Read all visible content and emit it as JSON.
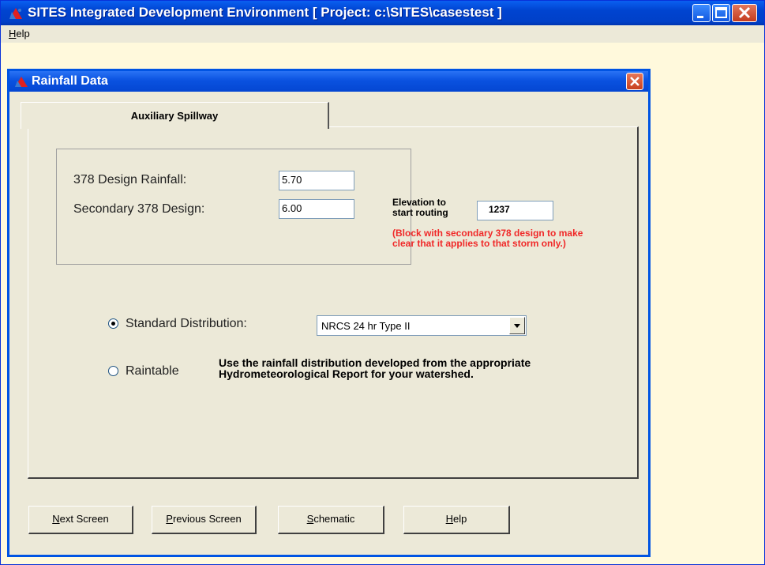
{
  "window": {
    "title": "SITES Integrated Development Environment [ Project: c:\\SITES\\casestest ]"
  },
  "menu": {
    "help_underlined": "H",
    "help_rest": "elp"
  },
  "dialog": {
    "title": "Rainfall Data",
    "tab_label": "Auxiliary Spillway",
    "design_rainfall_label": "378 Design Rainfall:",
    "design_rainfall_value": "5.70",
    "secondary_label": "Secondary 378 Design:",
    "secondary_value": "6.00",
    "elevation_label_1": "Elevation to",
    "elevation_label_2": "start routing",
    "elevation_value": "1237",
    "red_note": "(Block with secondary 378 design to make clear that it applies to that storm only.)",
    "standard_label": "Standard Distribution:",
    "standard_selected": true,
    "distribution_value": "NRCS 24 hr Type II",
    "raintable_label": "Raintable",
    "raintable_selected": false,
    "raintable_info": "Use the rainfall distribution developed from the appropriate Hydrometeorological Report for your watershed."
  },
  "buttons": {
    "next_u": "N",
    "next_rest": "ext Screen",
    "prev_u": "P",
    "prev_rest": "revious Screen",
    "schem_u": "S",
    "schem_rest": "chematic",
    "help_u": "H",
    "help_rest": "elp"
  },
  "colors": {
    "titlebar_blue": "#0044d0",
    "dialog_bg": "#ece9d8",
    "mdi_bg": "#fff9dc",
    "note_red": "#f02828"
  }
}
